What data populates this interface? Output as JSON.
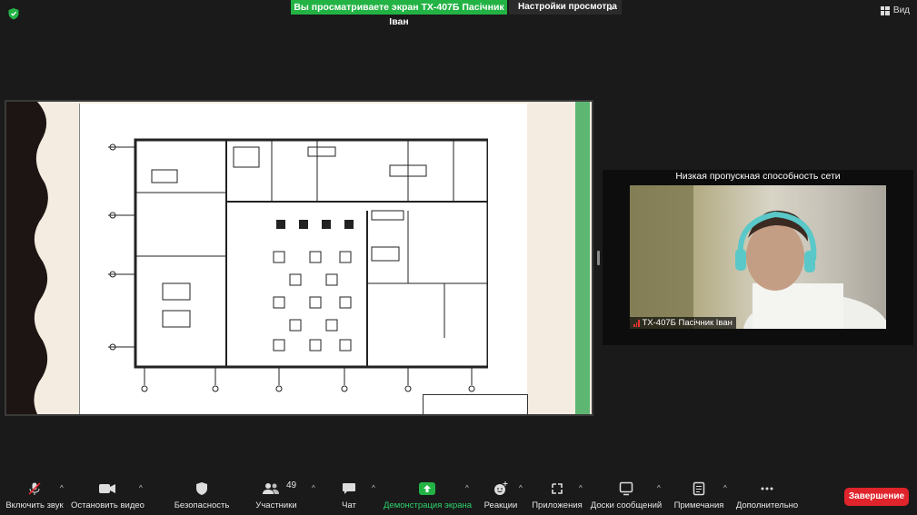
{
  "top": {
    "share_banner": "Вы просматриваете экран ТХ-407Б Пасічник Іван",
    "view_settings": "Настройки просмотра",
    "view_label": "Вид"
  },
  "video": {
    "network_warning": "Низкая пропускная способность сети",
    "participant_name": "ТХ-407Б Пасічник Іван"
  },
  "toolbar": {
    "items": [
      {
        "label": "Включить звук",
        "icon": "mic-muted-icon"
      },
      {
        "label": "Остановить видео",
        "icon": "video-camera-icon"
      },
      {
        "label": "Безопасность",
        "icon": "shield-icon"
      },
      {
        "label": "Участники",
        "icon": "participants-icon",
        "count": "49"
      },
      {
        "label": "Чат",
        "icon": "chat-icon"
      },
      {
        "label": "Демонстрация экрана",
        "icon": "share-screen-icon"
      },
      {
        "label": "Реакции",
        "icon": "reaction-icon"
      },
      {
        "label": "Приложения",
        "icon": "apps-icon"
      },
      {
        "label": "Доски сообщений",
        "icon": "whiteboard-icon"
      },
      {
        "label": "Примечания",
        "icon": "notes-icon"
      },
      {
        "label": "Дополнительно",
        "icon": "more-icon"
      }
    ],
    "end_label": "Завершение"
  },
  "colors": {
    "share_green": "#23b345",
    "end_red": "#e0242c",
    "background": "#1a1a1a"
  }
}
